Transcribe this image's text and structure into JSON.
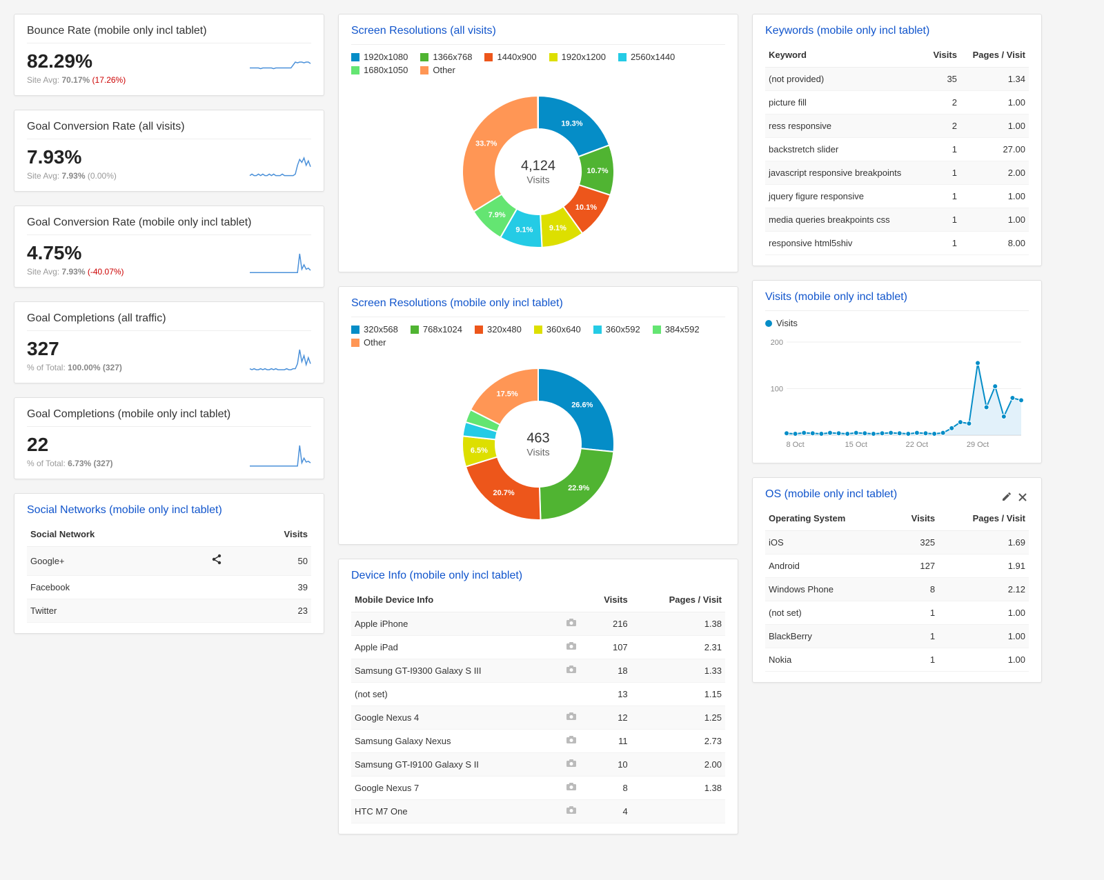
{
  "colors": {
    "c1": "#058dc7",
    "c2": "#50b432",
    "c3": "#ed561b",
    "c4": "#dddf00",
    "c5": "#24cbe5",
    "c6": "#64e572",
    "c7": "#ff9655"
  },
  "metrics": [
    {
      "title": "Bounce Rate (mobile only incl tablet)",
      "value": "82.29%",
      "sub_prefix": "Site Avg: ",
      "sub_val": "70.17%",
      "delta": "(17.26%)",
      "delta_class": "neg",
      "spark": [
        22,
        22,
        22,
        22,
        22,
        21,
        22,
        22,
        22,
        22,
        22,
        21,
        22,
        22,
        22,
        22,
        22,
        22,
        22,
        22,
        26,
        30,
        29,
        30,
        30,
        29,
        30,
        30,
        28
      ]
    },
    {
      "title": "Goal Conversion Rate (all visits)",
      "value": "7.93%",
      "sub_prefix": "Site Avg: ",
      "sub_val": "7.93%",
      "delta": "(0.00%)",
      "delta_class": "neu",
      "spark": [
        3,
        4,
        3,
        3,
        4,
        3,
        4,
        3,
        3,
        4,
        3,
        4,
        3,
        3,
        3,
        4,
        3,
        3,
        3,
        3,
        3,
        4,
        10,
        14,
        12,
        15,
        10,
        13,
        9
      ]
    },
    {
      "title": "Goal Conversion Rate (mobile only incl tablet)",
      "value": "4.75%",
      "sub_prefix": "Site Avg: ",
      "sub_val": "7.93%",
      "delta": "(-40.07%)",
      "delta_class": "neg",
      "spark": [
        3,
        3,
        3,
        3,
        3,
        3,
        3,
        3,
        3,
        3,
        3,
        3,
        3,
        3,
        3,
        3,
        3,
        3,
        3,
        3,
        3,
        3,
        3,
        20,
        6,
        10,
        6,
        7,
        5
      ]
    },
    {
      "title": "Goal Completions (all traffic)",
      "value": "327",
      "sub_prefix": "% of Total: ",
      "sub_val": "100.00% (327)",
      "delta": "",
      "delta_class": "neu",
      "spark": [
        3,
        2,
        3,
        2,
        2,
        3,
        2,
        3,
        2,
        2,
        3,
        2,
        3,
        2,
        2,
        2,
        2,
        3,
        2,
        2,
        3,
        3,
        8,
        22,
        10,
        16,
        7,
        14,
        8
      ]
    },
    {
      "title": "Goal Completions (mobile only incl tablet)",
      "value": "22",
      "sub_prefix": "% of Total: ",
      "sub_val": "6.73% (327)",
      "delta": "",
      "delta_class": "neu",
      "spark": [
        2,
        2,
        2,
        2,
        2,
        2,
        2,
        2,
        2,
        2,
        2,
        2,
        2,
        2,
        2,
        2,
        2,
        2,
        2,
        2,
        2,
        2,
        2,
        28,
        6,
        12,
        7,
        8,
        6
      ]
    }
  ],
  "social": {
    "title": "Social Networks (mobile only incl tablet)",
    "headers": [
      "Social Network",
      "Visits"
    ],
    "rows": [
      {
        "name": "Google+",
        "visits": 50,
        "icon": true
      },
      {
        "name": "Facebook",
        "visits": 39,
        "icon": false
      },
      {
        "name": "Twitter",
        "visits": 23,
        "icon": false
      }
    ]
  },
  "donut1": {
    "title": "Screen Resolutions (all visits)",
    "center_val": "4,124",
    "center_label": "Visits",
    "items": [
      {
        "label": "1920x1080",
        "pct": 19.3,
        "color": "c1"
      },
      {
        "label": "1366x768",
        "pct": 10.7,
        "color": "c2"
      },
      {
        "label": "1440x900",
        "pct": 10.1,
        "color": "c3"
      },
      {
        "label": "1920x1200",
        "pct": 9.1,
        "color": "c4"
      },
      {
        "label": "2560x1440",
        "pct": 9.1,
        "color": "c5"
      },
      {
        "label": "1680x1050",
        "pct": 7.9,
        "color": "c6"
      },
      {
        "label": "Other",
        "pct": 33.7,
        "color": "c7"
      }
    ]
  },
  "donut2": {
    "title": "Screen Resolutions (mobile only incl tablet)",
    "center_val": "463",
    "center_label": "Visits",
    "items": [
      {
        "label": "320x568",
        "pct": 26.6,
        "color": "c1"
      },
      {
        "label": "768x1024",
        "pct": 22.9,
        "color": "c2"
      },
      {
        "label": "320x480",
        "pct": 20.7,
        "color": "c3"
      },
      {
        "label": "360x640",
        "pct": 6.5,
        "color": "c4"
      },
      {
        "label": "360x592",
        "pct": 3.0,
        "color": "c5",
        "hidePct": true
      },
      {
        "label": "384x592",
        "pct": 2.8,
        "color": "c6",
        "hidePct": true
      },
      {
        "label": "Other",
        "pct": 17.5,
        "color": "c7"
      }
    ]
  },
  "deviceInfo": {
    "title": "Device Info (mobile only incl tablet)",
    "headers": [
      "Mobile Device Info",
      "",
      "Visits",
      "Pages / Visit"
    ],
    "rows": [
      {
        "name": "Apple iPhone",
        "cam": true,
        "visits": 216,
        "ppv": "1.38"
      },
      {
        "name": "Apple iPad",
        "cam": true,
        "visits": 107,
        "ppv": "2.31"
      },
      {
        "name": "Samsung GT-I9300 Galaxy S III",
        "cam": true,
        "visits": 18,
        "ppv": "1.33"
      },
      {
        "name": "(not set)",
        "cam": false,
        "visits": 13,
        "ppv": "1.15"
      },
      {
        "name": "Google Nexus 4",
        "cam": true,
        "visits": 12,
        "ppv": "1.25"
      },
      {
        "name": "Samsung Galaxy Nexus",
        "cam": true,
        "visits": 11,
        "ppv": "2.73"
      },
      {
        "name": "Samsung GT-I9100 Galaxy S II",
        "cam": true,
        "visits": 10,
        "ppv": "2.00"
      },
      {
        "name": "Google Nexus 7",
        "cam": true,
        "visits": 8,
        "ppv": "1.38"
      },
      {
        "name": "HTC M7 One",
        "cam": true,
        "visits": 4,
        "ppv": ""
      }
    ]
  },
  "keywords": {
    "title": "Keywords (mobile only incl tablet)",
    "headers": [
      "Keyword",
      "Visits",
      "Pages / Visit"
    ],
    "rows": [
      {
        "kw": "(not provided)",
        "visits": 35,
        "ppv": "1.34"
      },
      {
        "kw": "picture fill",
        "visits": 2,
        "ppv": "1.00"
      },
      {
        "kw": "ress responsive",
        "visits": 2,
        "ppv": "1.00"
      },
      {
        "kw": "backstretch slider",
        "visits": 1,
        "ppv": "27.00"
      },
      {
        "kw": "javascript responsive breakpoints",
        "visits": 1,
        "ppv": "2.00"
      },
      {
        "kw": "jquery figure responsive",
        "visits": 1,
        "ppv": "1.00"
      },
      {
        "kw": "media queries breakpoints css",
        "visits": 1,
        "ppv": "1.00"
      },
      {
        "kw": "responsive html5shiv",
        "visits": 1,
        "ppv": "8.00"
      }
    ]
  },
  "visitsChart": {
    "title": "Visits (mobile only incl tablet)",
    "legend": "Visits",
    "ylabels": [
      "100",
      "200"
    ],
    "xlabels": [
      "8 Oct",
      "15 Oct",
      "22 Oct",
      "29 Oct"
    ],
    "values": [
      4,
      3,
      5,
      4,
      3,
      5,
      4,
      3,
      5,
      4,
      3,
      4,
      5,
      4,
      3,
      5,
      4,
      3,
      5,
      15,
      28,
      25,
      155,
      60,
      105,
      40,
      80,
      75
    ]
  },
  "os": {
    "title": "OS (mobile only incl tablet)",
    "headers": [
      "Operating System",
      "Visits",
      "Pages / Visit"
    ],
    "rows": [
      {
        "name": "iOS",
        "visits": 325,
        "ppv": "1.69"
      },
      {
        "name": "Android",
        "visits": 127,
        "ppv": "1.91"
      },
      {
        "name": "Windows Phone",
        "visits": 8,
        "ppv": "2.12"
      },
      {
        "name": "(not set)",
        "visits": 1,
        "ppv": "1.00"
      },
      {
        "name": "BlackBerry",
        "visits": 1,
        "ppv": "1.00"
      },
      {
        "name": "Nokia",
        "visits": 1,
        "ppv": "1.00"
      }
    ]
  },
  "chart_data": [
    {
      "type": "pie",
      "title": "Screen Resolutions (all visits)",
      "categories": [
        "1920x1080",
        "1366x768",
        "1440x900",
        "1920x1200",
        "2560x1440",
        "1680x1050",
        "Other"
      ],
      "values": [
        19.3,
        10.7,
        10.1,
        9.1,
        9.1,
        7.9,
        33.7
      ],
      "center": "4,124 Visits"
    },
    {
      "type": "pie",
      "title": "Screen Resolutions (mobile only incl tablet)",
      "categories": [
        "320x568",
        "768x1024",
        "320x480",
        "360x640",
        "360x592",
        "384x592",
        "Other"
      ],
      "values": [
        26.6,
        22.9,
        20.7,
        6.5,
        3.0,
        2.8,
        17.5
      ],
      "center": "463 Visits"
    },
    {
      "type": "line",
      "title": "Visits (mobile only incl tablet)",
      "series": [
        {
          "name": "Visits",
          "values": [
            4,
            3,
            5,
            4,
            3,
            5,
            4,
            3,
            5,
            4,
            3,
            4,
            5,
            4,
            3,
            5,
            4,
            3,
            5,
            15,
            28,
            25,
            155,
            60,
            105,
            40,
            80,
            75
          ]
        }
      ],
      "ylim": [
        0,
        200
      ],
      "x_tick_labels": [
        "8 Oct",
        "15 Oct",
        "22 Oct",
        "29 Oct"
      ]
    }
  ]
}
